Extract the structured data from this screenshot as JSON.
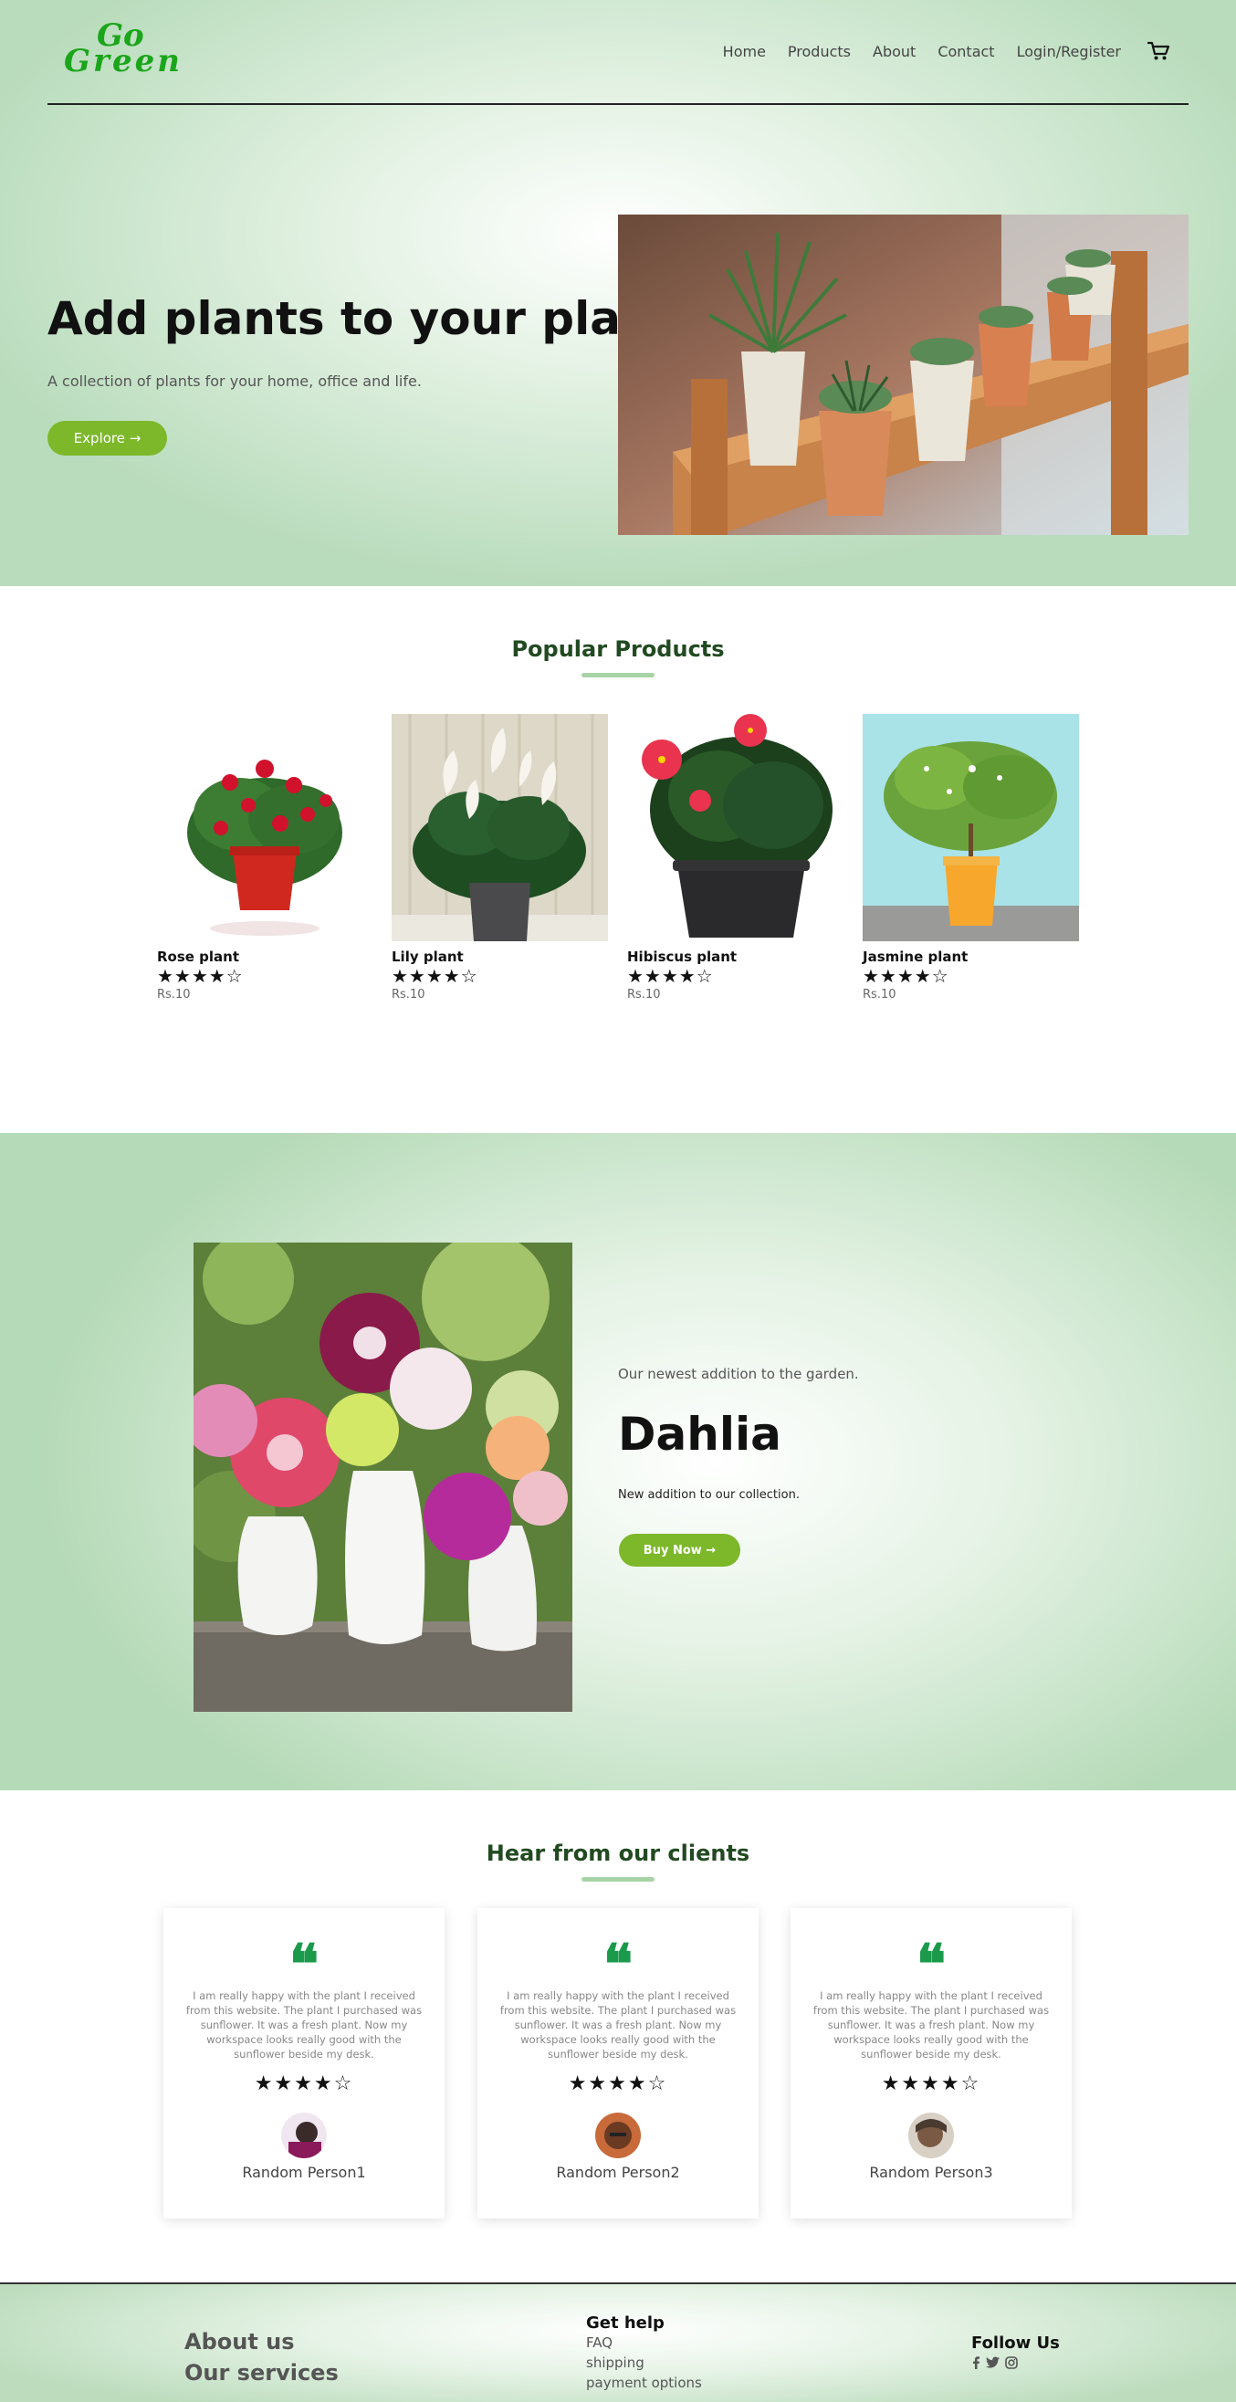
{
  "brand": {
    "logo_line1": "Go",
    "logo_line2": "Green"
  },
  "nav": {
    "items": [
      "Home",
      "Products",
      "About",
      "Contact",
      "Login/Register"
    ]
  },
  "hero": {
    "title": "Add plants to your place",
    "subtitle": "A collection of plants for your home, office and life.",
    "cta": "Explore →"
  },
  "popular": {
    "title": "Popular Products",
    "products": [
      {
        "name": "Rose plant",
        "stars": "★★★★☆",
        "rating": 4,
        "price": "Rs.10"
      },
      {
        "name": "Lily plant",
        "stars": "★★★★☆",
        "rating": 4,
        "price": "Rs.10"
      },
      {
        "name": "Hibiscus plant",
        "stars": "★★★★☆",
        "rating": 4,
        "price": "Rs.10"
      },
      {
        "name": "Jasmine plant",
        "stars": "★★★★☆",
        "rating": 4,
        "price": "Rs.10"
      }
    ]
  },
  "featured": {
    "kicker": "Our newest addition to the garden.",
    "title": "Dahlia",
    "description": "New addition to our collection.",
    "cta": "Buy Now →"
  },
  "testimonials": {
    "title": "Hear from our clients",
    "items": [
      {
        "quote_mark": "❝",
        "text": "I am really happy with the plant I received from this website. The plant I purchased was sunflower. It was a fresh plant. Now my workspace looks really good with the sunflower beside my desk.",
        "stars": "★★★★☆",
        "rating": 4,
        "name": "Random Person1"
      },
      {
        "quote_mark": "❝",
        "text": "I am really happy with the plant I received from this website. The plant I purchased was sunflower. It was a fresh plant. Now my workspace looks really good with the sunflower beside my desk.",
        "stars": "★★★★☆",
        "rating": 4,
        "name": "Random Person2"
      },
      {
        "quote_mark": "❝",
        "text": "I am really happy with the plant I received from this website. The plant I purchased was sunflower. It was a fresh plant. Now my workspace looks really good with the sunflower beside my desk.",
        "stars": "★★★★☆",
        "rating": 4,
        "name": "Random Person3"
      }
    ]
  },
  "footer": {
    "about": "About us",
    "services": "Our services",
    "help_title": "Get help",
    "help_items": [
      "FAQ",
      "shipping",
      "payment options"
    ],
    "follow_title": "Follow Us",
    "social_icons": [
      "facebook-icon",
      "twitter-icon",
      "instagram-icon"
    ]
  },
  "colors": {
    "accent": "#7cb82a",
    "logo": "#1aa51a",
    "quote": "#1a9a4a",
    "heading": "#214a21"
  }
}
